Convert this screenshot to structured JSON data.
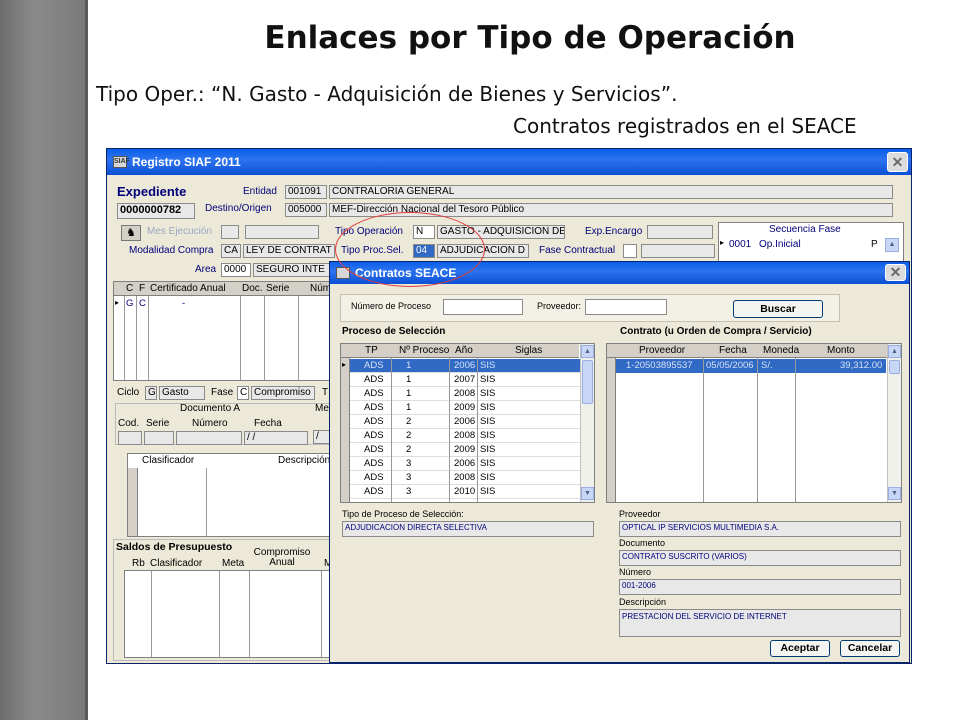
{
  "slide": {
    "title": "Enlaces por Tipo de Operación",
    "subtitle": "Tipo Oper.: “N. Gasto - Adquisición de Bienes y Servicios”.",
    "subtitle2": "Contratos registrados en el SEACE"
  },
  "siaf": {
    "title": "Registro SIAF 2011",
    "icon": "SIAF",
    "close": "✕",
    "expediente_label": "Expediente",
    "expediente_value": "0000000782",
    "entidad_label": "Entidad",
    "entidad_code": "001091",
    "entidad_name": "CONTRALORIA GENERAL",
    "destino_label": "Destino/Origen",
    "destino_code": "005000",
    "destino_name": "MEF-Dirección Nacional del Tesoro Público",
    "meta_ejecucion": "Mes Ejecución",
    "tipo_operacion_label": "Tipo Operación",
    "tipo_operacion_code": "N",
    "tipo_operacion_value": "GASTO - ADQUISICION DE",
    "exp_encargo": "Exp.Encargo",
    "secuencia_fase": "Secuencia Fase",
    "modalidad_label": "Modalidad Compra",
    "modalidad_code": "CA",
    "modalidad_value": "LEY DE CONTRAT",
    "tipo_proc_label": "Tipo Proc.Sel.",
    "tipo_proc_code": "04",
    "tipo_proc_value": "ADJUDICACION D",
    "fase_contractual": "Fase Contractual",
    "sec_code": "0001",
    "sec_value": "Op.Inicial",
    "sec_p": "P",
    "area_label": "Area",
    "area_code": "0000",
    "area_value": "SEGURO INTE",
    "grid_headers": {
      "c": "C",
      "f": "F",
      "cert": "Certificado Anual",
      "doc": "Doc.",
      "serie": "Serie",
      "num": "Núm"
    },
    "grid_row": {
      "c": "G",
      "f": "C",
      "dash": "-"
    },
    "ciclo_label": "Ciclo",
    "ciclo_code": "G",
    "ciclo_value": "Gasto",
    "fase_label": "Fase",
    "fase_code": "C",
    "fase_value": "Compromiso",
    "t_label": "T",
    "documento_a": "Documento A",
    "me_label": "Me",
    "cod_label": "Cod.",
    "serie_label": "Serie",
    "numero_label": "Número",
    "fecha_label": "Fecha",
    "fecha_value": "/ /",
    "fecha_value2": "/",
    "clasificador": "Clasificador",
    "descripcion": "Descripción",
    "saldos": "Saldos de Presupuesto",
    "compromiso_anual": "Compromiso Anual",
    "rb": "Rb",
    "clasif2": "Clasificador",
    "meta": "Meta",
    "m_label": "M"
  },
  "seace": {
    "title": "Contratos SEACE",
    "close": "✕",
    "numero_proceso_label": "Número de Proceso",
    "proveedor_label": "Proveedor:",
    "buscar": "Buscar",
    "proceso_seleccion": "Proceso de Selección",
    "contrato_label": "Contrato (u Orden de Compra / Servicio)",
    "left_headers": {
      "tp": "TP",
      "np": "Nº Proceso",
      "anio": "Año",
      "siglas": "Siglas"
    },
    "left_rows": [
      {
        "tp": "ADS",
        "np": "1",
        "anio": "2006",
        "siglas": "SIS"
      },
      {
        "tp": "ADS",
        "np": "1",
        "anio": "2007",
        "siglas": "SIS"
      },
      {
        "tp": "ADS",
        "np": "1",
        "anio": "2008",
        "siglas": "SIS"
      },
      {
        "tp": "ADS",
        "np": "1",
        "anio": "2009",
        "siglas": "SIS"
      },
      {
        "tp": "ADS",
        "np": "2",
        "anio": "2006",
        "siglas": "SIS"
      },
      {
        "tp": "ADS",
        "np": "2",
        "anio": "2008",
        "siglas": "SIS"
      },
      {
        "tp": "ADS",
        "np": "2",
        "anio": "2009",
        "siglas": "SIS"
      },
      {
        "tp": "ADS",
        "np": "3",
        "anio": "2006",
        "siglas": "SIS"
      },
      {
        "tp": "ADS",
        "np": "3",
        "anio": "2008",
        "siglas": "SIS"
      },
      {
        "tp": "ADS",
        "np": "3",
        "anio": "2010",
        "siglas": "SIS"
      }
    ],
    "right_headers": {
      "prov": "Proveedor",
      "fecha": "Fecha",
      "moneda": "Moneda",
      "monto": "Monto"
    },
    "right_row": {
      "prov": "1-20503895537",
      "fecha": "05/05/2006",
      "moneda": "S/.",
      "monto": "39,312.00"
    },
    "tipo_proceso_label": "Tipo de Proceso de Selección:",
    "tipo_proceso_value": "ADJUDICACION DIRECTA SELECTIVA",
    "proveedor2_label": "Proveedor",
    "proveedor2_value": "OPTICAL IP SERVICIOS MULTIMEDIA S.A.",
    "documento_label": "Documento",
    "documento_value": "CONTRATO SUSCRITO (VARIOS)",
    "numero_label": "Número",
    "numero_value": "001-2006",
    "descripcion_label": "Descripción",
    "descripcion_value": "PRESTACION DEL SERVICIO DE INTERNET",
    "aceptar": "Aceptar",
    "cancelar": "Cancelar"
  },
  "colors": {
    "highlight": "#e23b3b",
    "xp_blue": "#0a5ee8",
    "selection": "#316ac5"
  }
}
